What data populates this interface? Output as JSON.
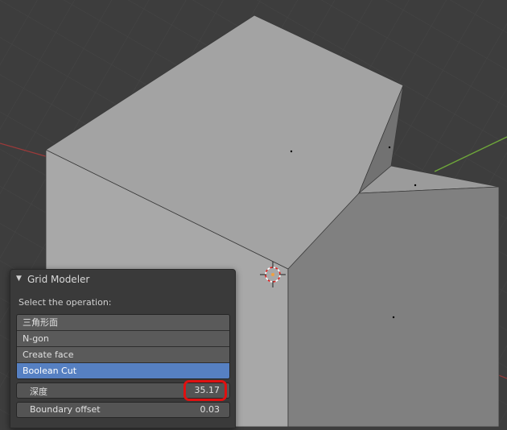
{
  "panel": {
    "title": "Grid Modeler",
    "prompt": "Select the operation:",
    "operations": [
      {
        "label": "三角形面",
        "selected": false
      },
      {
        "label": "N-gon",
        "selected": false
      },
      {
        "label": "Create face",
        "selected": false
      },
      {
        "label": "Boolean Cut",
        "selected": true
      }
    ],
    "depth": {
      "label": "深度",
      "value": "35.17"
    },
    "boundary_offset": {
      "label": "Boundary offset",
      "value": "0.03"
    }
  },
  "colors": {
    "viewport_bg": "#3d3d3d",
    "selected_item": "#5680c2",
    "highlight_ring": "#e01010",
    "x_axis": "#9b3a3a",
    "y_axis": "#6fa83a"
  }
}
